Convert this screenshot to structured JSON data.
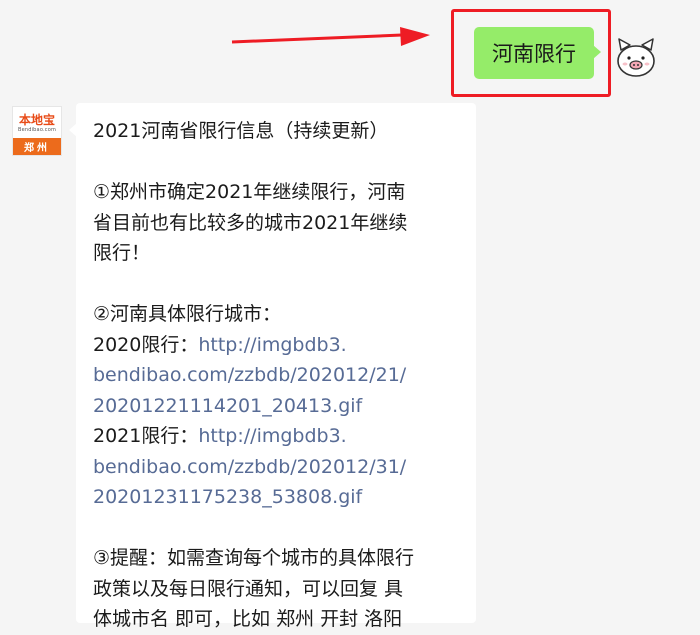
{
  "outgoing": {
    "text": "河南限行"
  },
  "sender": {
    "brand_cn": "本地宝",
    "brand_en": "Bendibao.com",
    "city": "郑州"
  },
  "incoming": {
    "title": "2021河南省限行信息（持续更新）",
    "p1": [
      "①郑州市确定2021年继续限行，河南",
      "省目前也有比较多的城市2021年继续",
      "限行！"
    ],
    "p2_heading": "②河南具体限行城市：",
    "y2020_label": "2020限行：",
    "y2020_link": [
      "http://imgbdb3.",
      "bendibao.com/zzbdb/202012/21/",
      "20201221114201_20413.gif"
    ],
    "y2021_label": "2021限行：",
    "y2021_link": [
      "http://imgbdb3.",
      "bendibao.com/zzbdb/202012/31/",
      "20201231175238_53808.gif"
    ],
    "p3": [
      "③提醒：如需查询每个城市的具体限行",
      "政策以及每日限行通知，可以回复 具",
      "体城市名 即可，比如 郑州 开封 洛阳"
    ]
  },
  "colors": {
    "bubble_green": "#95ec69",
    "link": "#576b95",
    "highlight": "#ee1c24",
    "brand_orange": "#ec6b1c"
  },
  "icons": {
    "self_avatar": "pig-face",
    "annotation": "red-arrow"
  }
}
